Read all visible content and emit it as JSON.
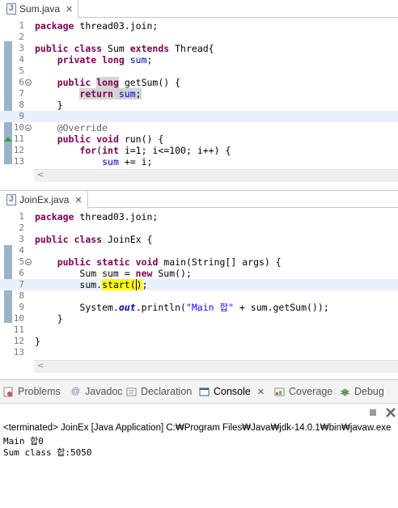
{
  "editor1": {
    "tab_label": "Sum.java",
    "lines": [
      "1",
      "2",
      "3",
      "4",
      "5",
      "6",
      "7",
      "8",
      "9",
      "10",
      "11",
      "12",
      "13"
    ]
  },
  "editor2": {
    "tab_label": "JoinEx.java",
    "lines": [
      "1",
      "2",
      "3",
      "4",
      "5",
      "6",
      "7",
      "8",
      "9",
      "10",
      "11",
      "12",
      "13"
    ]
  },
  "code1": {
    "l1_kw": "package",
    "l1_rest": " thread03.join;",
    "l3_kw1": "public",
    "l3_kw2": "class",
    "l3_name": " Sum ",
    "l3_kw3": "extends",
    "l3_rest": " Thread{",
    "l4_kw1": "private",
    "l4_kw2": "long",
    "l4_fld": "sum",
    "l4_rest": ";",
    "l6_kw1": "public",
    "l6_kw2": "long",
    "l6_rest": " getSum() {",
    "l7_kw": "return",
    "l7_fld": "sum",
    "l7_rest": ";",
    "l8": "}",
    "l10": "@Override",
    "l11_kw1": "public",
    "l11_kw2": "void",
    "l11_rest": " run() {",
    "l12_kw": "for",
    "l12_a": "(",
    "l12_kw2": "int",
    "l12_rest": " i=1; i<=100; i++) {",
    "l13_fld": "sum",
    "l13_rest": " += i;"
  },
  "code2": {
    "l1_kw": "package",
    "l1_rest": " thread03.join;",
    "l3_kw1": "public",
    "l3_kw2": "class",
    "l3_rest": " JoinEx {",
    "l5_kw1": "public",
    "l5_kw2": "static",
    "l5_kw3": "void",
    "l5_rest": " main(String[] args) {",
    "l6_a": "Sum sum = ",
    "l6_kw": "new",
    "l6_rest": " Sum();",
    "l7_a": "sum.",
    "l7_hl": "start(",
    "l7_caret": ")",
    "l7_rest": ";",
    "l9_a": "System.",
    "l9_out": "out",
    "l9_b": ".println(",
    "l9_str": "\"Main 합\"",
    "l9_rest": " + sum.getSum());",
    "l10": "}",
    "l12": "}"
  },
  "views": {
    "problems": "Problems",
    "javadoc": "Javadoc",
    "declaration": "Declaration",
    "console": "Console",
    "coverage": "Coverage",
    "debug": "Debug"
  },
  "console": {
    "header": "<terminated> JoinEx [Java Application] C:₩Program Files₩Java₩jdk-14.0.1₩bin₩javaw.exe",
    "output": [
      "Main 합0",
      "Sum class 합:5050"
    ]
  },
  "colors": {
    "keyword": "#7f0055",
    "field": "#0000c0",
    "string": "#2a00ff",
    "highlight": "#ffff00",
    "current_line": "#e8f2fe"
  }
}
